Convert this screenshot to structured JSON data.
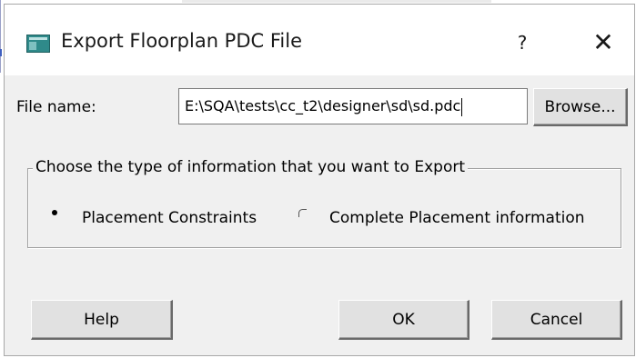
{
  "window": {
    "title": "Export Floorplan PDC File",
    "help_glyph": "?",
    "close_glyph": "✕",
    "icon": "app-window-icon"
  },
  "file": {
    "label": "File name:",
    "value": "E:\\SQA\\tests\\cc_t2\\designer\\sd\\sd.pdc",
    "browse_label": "Browse..."
  },
  "export_type": {
    "legend": "Choose the type of information that you want to Export",
    "options": [
      {
        "label": "Placement Constraints",
        "selected": true
      },
      {
        "label": "Complete Placement information",
        "selected": false
      }
    ]
  },
  "buttons": {
    "help": "Help",
    "ok": "OK",
    "cancel": "Cancel"
  }
}
